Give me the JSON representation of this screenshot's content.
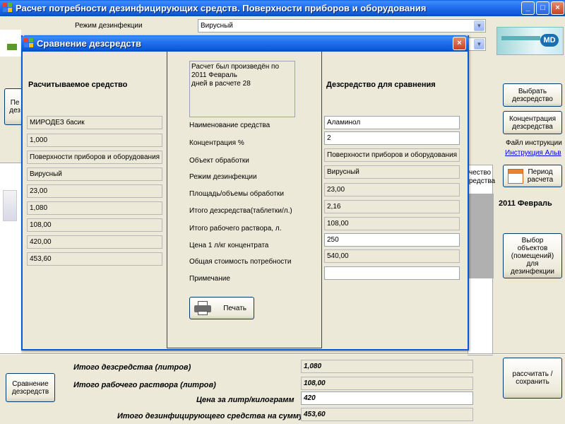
{
  "main_window": {
    "title": "Расчет потребности дезинфицирующих средств. Поверхности приборов и оборудования",
    "mode_label": "Режим дезинфекции",
    "mode_value": "Вирусный",
    "buttons": {
      "choose": "Выбрать дезсредство",
      "concentration": "Концентрация дезсредства",
      "period": "Период расчета",
      "objects": "Выбор объектов (помещений) для дезинфекции",
      "calc_save": "рассчитать / сохранить",
      "compare": "Сравнение дезсредств",
      "left_partial": "Пе\nдез"
    },
    "instruction_label": "Файл инструкции",
    "instruction_link": "Инструкция Альв",
    "period_value": "2011 Февраль",
    "table_frag_1": "чество",
    "table_frag_2": "редства",
    "totals": [
      {
        "label": "Итого дезсредства (литров)",
        "value": "1,080"
      },
      {
        "label": "Итого рабочего раствора (литров)",
        "value": "108,00"
      },
      {
        "label": "Цена за литр/килограмм",
        "value": "420"
      },
      {
        "label": "Итого дезинфицирующего средства на сумму",
        "value": "453,60"
      }
    ]
  },
  "dialog": {
    "title": "Сравнение дезсредств",
    "left_heading": "Расчитываемое средство",
    "right_heading": "Дезсредство для сравнения",
    "calc_note": "Расчет был произведён по\n2011 Февраль\nдней в расчете 28",
    "rows": [
      {
        "label": "Наименование средства",
        "left": "МИРОДЕЗ басик",
        "right": "Аламинол"
      },
      {
        "label": "Концентрация %",
        "left": "1,000",
        "right": "2"
      },
      {
        "label": "Объект обработки",
        "left": "Поверхности приборов и оборудования",
        "right": "Поверхности приборов и оборудования"
      },
      {
        "label": "Режим дезинфекции",
        "left": "Вирусный",
        "right": "Вирусный"
      },
      {
        "label": "Площадь/объемы обработки",
        "left": "23,00",
        "right": "23,00"
      },
      {
        "label": "Итого дезсредства(таблетки/л.)",
        "left": "1,080",
        "right": "2,16"
      },
      {
        "label": "Итого рабочего раствора, л.",
        "left": "108,00",
        "right": "108,00"
      },
      {
        "label": "Цена 1 л/кг концентрата",
        "left": "420,00",
        "right": "250"
      },
      {
        "label": "Общая стоимость потребности",
        "left": "453,60",
        "right": "540,00"
      },
      {
        "label": "Примечание",
        "left": "",
        "right": ""
      }
    ],
    "print_label": "Печать"
  },
  "colors": {
    "xp_blue": "#0a5bd8",
    "face": "#ece9d8",
    "logo_teal": "#1a8f9a"
  }
}
